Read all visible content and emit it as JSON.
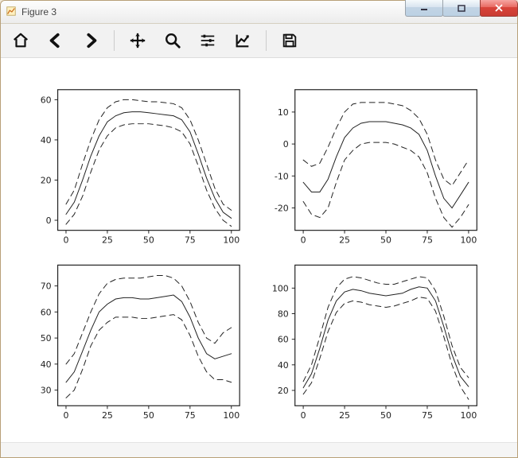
{
  "window": {
    "title": "Figure 3"
  },
  "toolbar": {
    "home": "Home",
    "back": "Back",
    "forward": "Forward",
    "pan": "Pan",
    "zoom": "Zoom",
    "subplots": "Configure subplots",
    "axes": "Edit axes",
    "save": "Save"
  },
  "chart_data": [
    {
      "type": "line",
      "xlabel": "",
      "ylabel": "",
      "xlim": [
        -5,
        105
      ],
      "ylim": [
        -5,
        65
      ],
      "xticks": [
        0,
        25,
        50,
        75,
        100
      ],
      "yticks": [
        0,
        20,
        40,
        60
      ],
      "color": "#e41a1c",
      "x": [
        0,
        5,
        10,
        15,
        20,
        25,
        30,
        35,
        40,
        45,
        50,
        55,
        60,
        65,
        70,
        75,
        80,
        85,
        90,
        95,
        100
      ],
      "series": [
        {
          "name": "upper",
          "style": "dashed",
          "y": [
            8,
            15,
            28,
            40,
            50,
            56,
            59,
            60,
            60,
            59.5,
            59,
            59,
            58.5,
            58,
            56,
            50,
            40,
            28,
            16,
            8,
            5
          ]
        },
        {
          "name": "mean",
          "style": "solid",
          "y": [
            3,
            9,
            20,
            32,
            42,
            49,
            52,
            53.5,
            54,
            54,
            53.5,
            53,
            52.5,
            52,
            50,
            44,
            33,
            21,
            11,
            4,
            1
          ]
        },
        {
          "name": "lower",
          "style": "dashed",
          "y": [
            -2,
            3,
            12,
            24,
            35,
            42,
            46,
            47.5,
            48,
            48,
            48,
            47.5,
            47,
            46,
            44,
            38,
            27,
            15,
            6,
            0,
            -3
          ]
        }
      ]
    },
    {
      "type": "line",
      "xlabel": "",
      "ylabel": "",
      "xlim": [
        -5,
        105
      ],
      "ylim": [
        -27,
        17
      ],
      "xticks": [
        0,
        25,
        50,
        75,
        100
      ],
      "yticks": [
        -20,
        -10,
        0,
        10
      ],
      "color": "#228b22",
      "x": [
        0,
        5,
        10,
        15,
        20,
        25,
        30,
        35,
        40,
        45,
        50,
        55,
        60,
        65,
        70,
        75,
        80,
        85,
        90,
        95,
        100
      ],
      "series": [
        {
          "name": "upper",
          "style": "dashed",
          "y": [
            -5,
            -7,
            -6,
            -1,
            5,
            10,
            12.5,
            13,
            13,
            13,
            13,
            12.5,
            12,
            10.5,
            8,
            3,
            -5,
            -11,
            -13,
            -9,
            -5
          ]
        },
        {
          "name": "mean",
          "style": "solid",
          "y": [
            -12,
            -15,
            -15,
            -11,
            -4,
            2,
            5,
            6.5,
            7,
            7,
            7,
            6.5,
            6,
            5,
            3,
            -2,
            -10,
            -17,
            -20,
            -16,
            -12
          ]
        },
        {
          "name": "lower",
          "style": "dashed",
          "y": [
            -18,
            -22,
            -23,
            -20,
            -12,
            -5,
            -2,
            0,
            0.5,
            0.5,
            0.5,
            0,
            -1,
            -2,
            -4,
            -9,
            -17,
            -23,
            -26,
            -23,
            -19
          ]
        }
      ]
    },
    {
      "type": "line",
      "xlabel": "",
      "ylabel": "",
      "xlim": [
        -5,
        105
      ],
      "ylim": [
        24,
        78
      ],
      "xticks": [
        0,
        25,
        50,
        75,
        100
      ],
      "yticks": [
        30,
        40,
        50,
        60,
        70
      ],
      "color": "#1f3fde",
      "x": [
        0,
        5,
        10,
        15,
        20,
        25,
        30,
        35,
        40,
        45,
        50,
        55,
        60,
        65,
        70,
        75,
        80,
        85,
        90,
        95,
        100
      ],
      "series": [
        {
          "name": "upper",
          "style": "dashed",
          "y": [
            40,
            44,
            52,
            60,
            67,
            71,
            72.5,
            73,
            73,
            73,
            73.5,
            74,
            74,
            73,
            70,
            64,
            56,
            50,
            48,
            52,
            54
          ]
        },
        {
          "name": "mean",
          "style": "solid",
          "y": [
            33,
            37,
            45,
            53,
            60,
            63,
            65,
            65.5,
            65.5,
            65,
            65,
            65.5,
            66,
            66.5,
            64,
            58,
            50,
            44,
            42,
            43,
            44
          ]
        },
        {
          "name": "lower",
          "style": "dashed",
          "y": [
            27,
            30,
            38,
            47,
            53,
            56,
            58,
            58,
            58,
            57.5,
            57.5,
            58,
            58.5,
            59,
            57,
            51,
            43,
            37,
            34,
            34,
            33
          ]
        }
      ]
    },
    {
      "type": "line",
      "xlabel": "",
      "ylabel": "",
      "xlim": [
        -5,
        105
      ],
      "ylim": [
        8,
        118
      ],
      "xticks": [
        0,
        25,
        50,
        75,
        100
      ],
      "yticks": [
        20,
        40,
        60,
        80,
        100
      ],
      "color": "#f2a71b",
      "x": [
        0,
        5,
        10,
        15,
        20,
        25,
        30,
        35,
        40,
        45,
        50,
        55,
        60,
        65,
        70,
        75,
        80,
        85,
        90,
        95,
        100
      ],
      "series": [
        {
          "name": "upper",
          "style": "dashed",
          "y": [
            27,
            40,
            62,
            85,
            100,
            107,
            109,
            108,
            106,
            104,
            103,
            103,
            105,
            107,
            109,
            108,
            98,
            78,
            55,
            38,
            30
          ]
        },
        {
          "name": "mean",
          "style": "solid",
          "y": [
            22,
            33,
            53,
            75,
            90,
            97,
            99,
            98,
            96,
            95,
            94,
            95,
            96,
            99,
            101,
            100,
            90,
            70,
            48,
            31,
            23
          ]
        },
        {
          "name": "lower",
          "style": "dashed",
          "y": [
            17,
            26,
            45,
            66,
            81,
            88,
            90,
            89,
            87,
            86,
            85,
            86,
            88,
            90,
            93,
            92,
            82,
            62,
            40,
            23,
            13
          ]
        }
      ]
    }
  ]
}
